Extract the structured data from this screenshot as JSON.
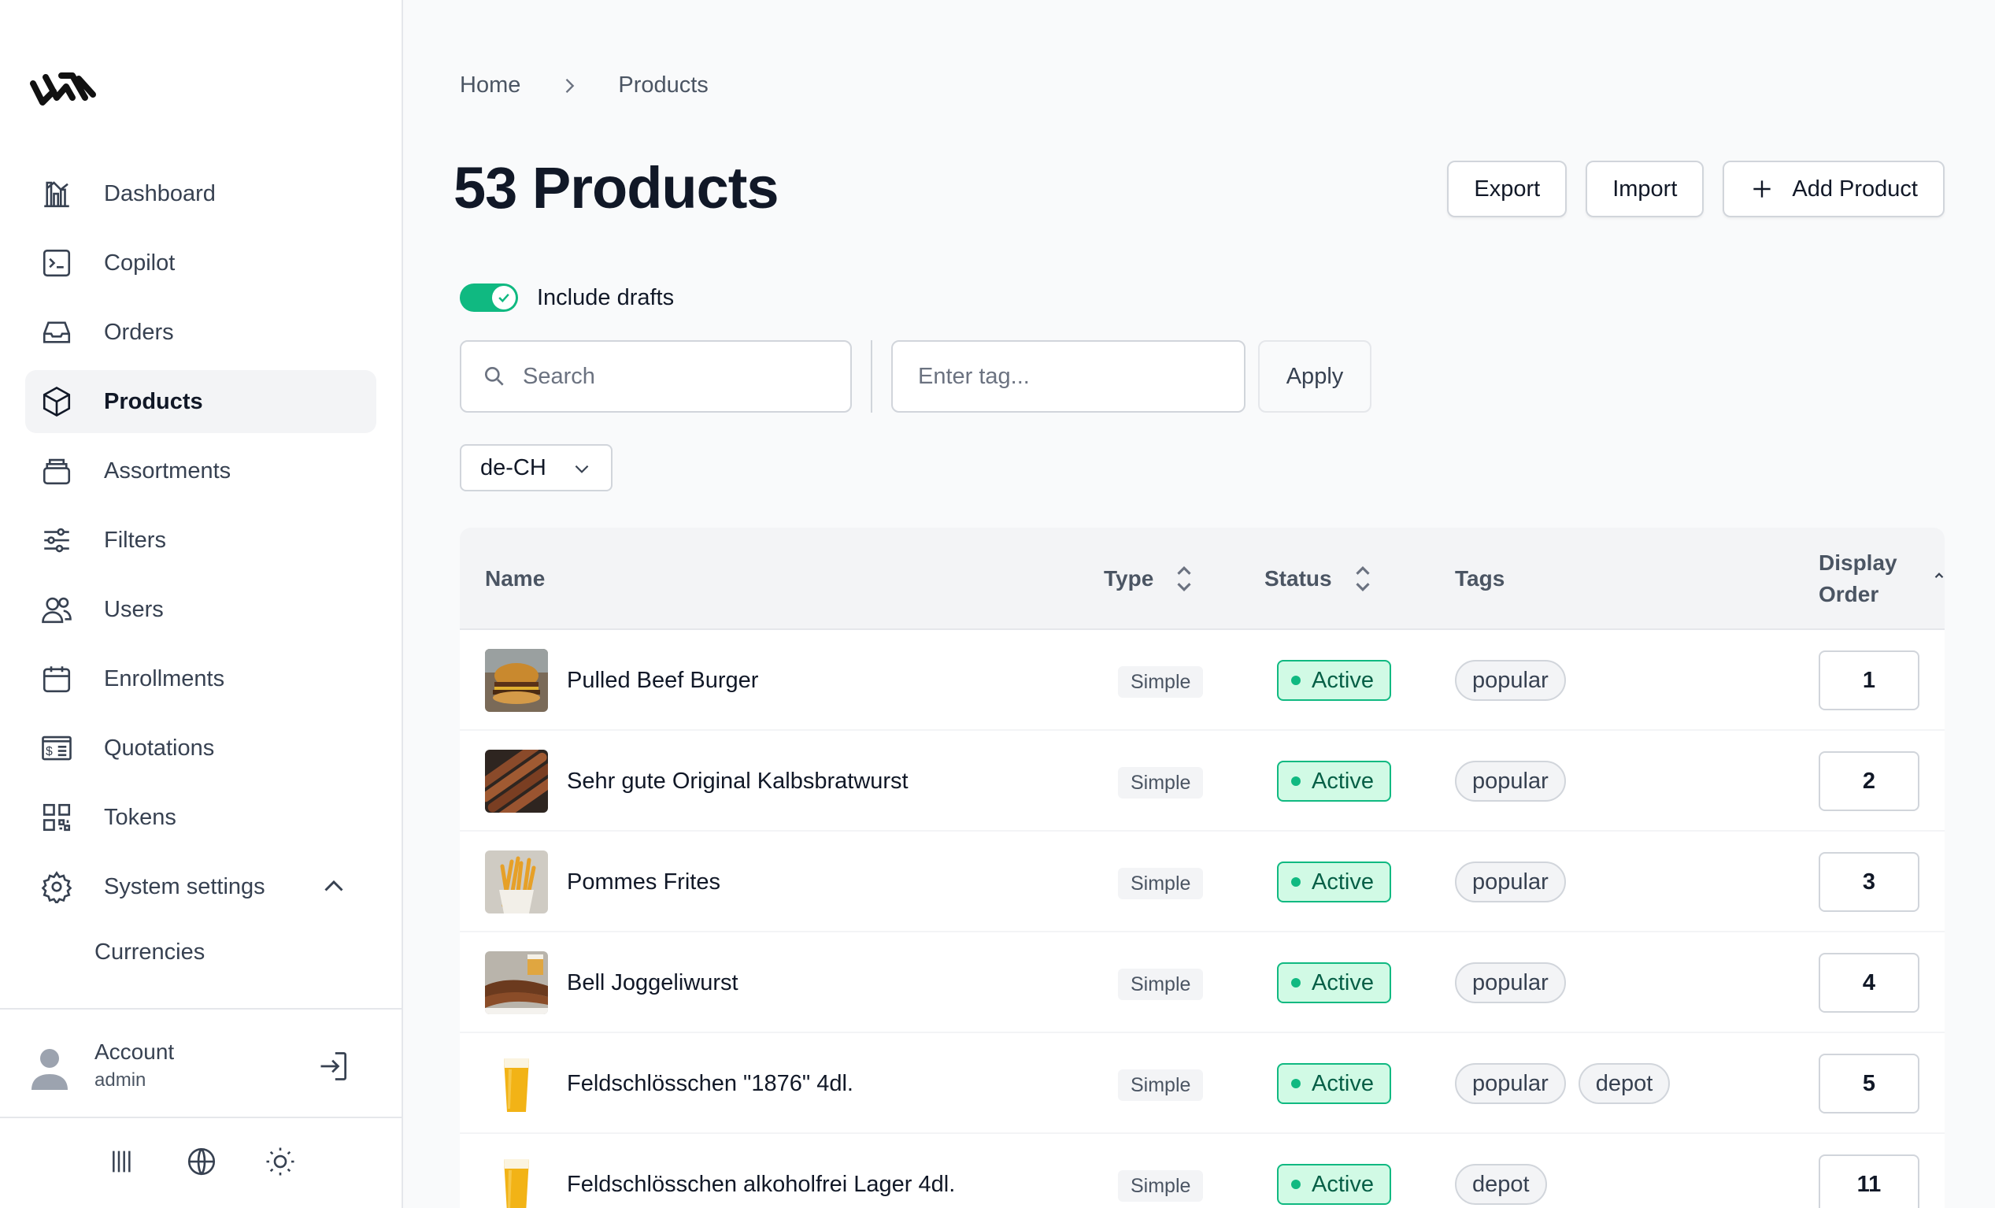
{
  "sidebar": {
    "items": [
      {
        "label": "Dashboard",
        "icon": "dashboard-icon"
      },
      {
        "label": "Copilot",
        "icon": "terminal-icon"
      },
      {
        "label": "Orders",
        "icon": "inbox-icon"
      },
      {
        "label": "Products",
        "icon": "cube-icon",
        "active": true
      },
      {
        "label": "Assortments",
        "icon": "stack-icon"
      },
      {
        "label": "Filters",
        "icon": "sliders-icon"
      },
      {
        "label": "Users",
        "icon": "users-icon"
      },
      {
        "label": "Enrollments",
        "icon": "calendar-icon"
      },
      {
        "label": "Quotations",
        "icon": "quotation-icon"
      },
      {
        "label": "Tokens",
        "icon": "qrcode-icon"
      },
      {
        "label": "System settings",
        "icon": "gear-icon"
      }
    ],
    "sub_items": [
      {
        "label": "Currencies"
      }
    ],
    "account": {
      "name": "Account",
      "role": "admin"
    }
  },
  "breadcrumb": {
    "home": "Home",
    "current": "Products"
  },
  "page": {
    "title": "53 Products"
  },
  "actions": {
    "export": "Export",
    "import": "Import",
    "add": "Add Product"
  },
  "toggle": {
    "label": "Include drafts",
    "on": true
  },
  "filters": {
    "search_placeholder": "Search",
    "tag_placeholder": "Enter tag...",
    "apply": "Apply",
    "locale": "de-CH"
  },
  "table": {
    "headers": {
      "name": "Name",
      "type": "Type",
      "status": "Status",
      "tags": "Tags",
      "order_line1": "Display",
      "order_line2": "Order"
    },
    "rows": [
      {
        "name": "Pulled Beef Burger",
        "type": "Simple",
        "status": "Active",
        "tags": [
          "popular"
        ],
        "order": "1"
      },
      {
        "name": "Sehr gute Original Kalbsbratwurst",
        "type": "Simple",
        "status": "Active",
        "tags": [
          "popular"
        ],
        "order": "2"
      },
      {
        "name": "Pommes Frites",
        "type": "Simple",
        "status": "Active",
        "tags": [
          "popular"
        ],
        "order": "3"
      },
      {
        "name": "Bell Joggeliwurst",
        "type": "Simple",
        "status": "Active",
        "tags": [
          "popular"
        ],
        "order": "4"
      },
      {
        "name": "Feldschlösschen \"1876\" 4dl.",
        "type": "Simple",
        "status": "Active",
        "tags": [
          "popular",
          "depot"
        ],
        "order": "5"
      },
      {
        "name": "Feldschlösschen alkoholfrei Lager 4dl.",
        "type": "Simple",
        "status": "Active",
        "tags": [
          "depot"
        ],
        "order": "11"
      }
    ]
  },
  "colors": {
    "accent": "#10b981",
    "active_bg": "#d1fae5",
    "text": "#111827"
  }
}
